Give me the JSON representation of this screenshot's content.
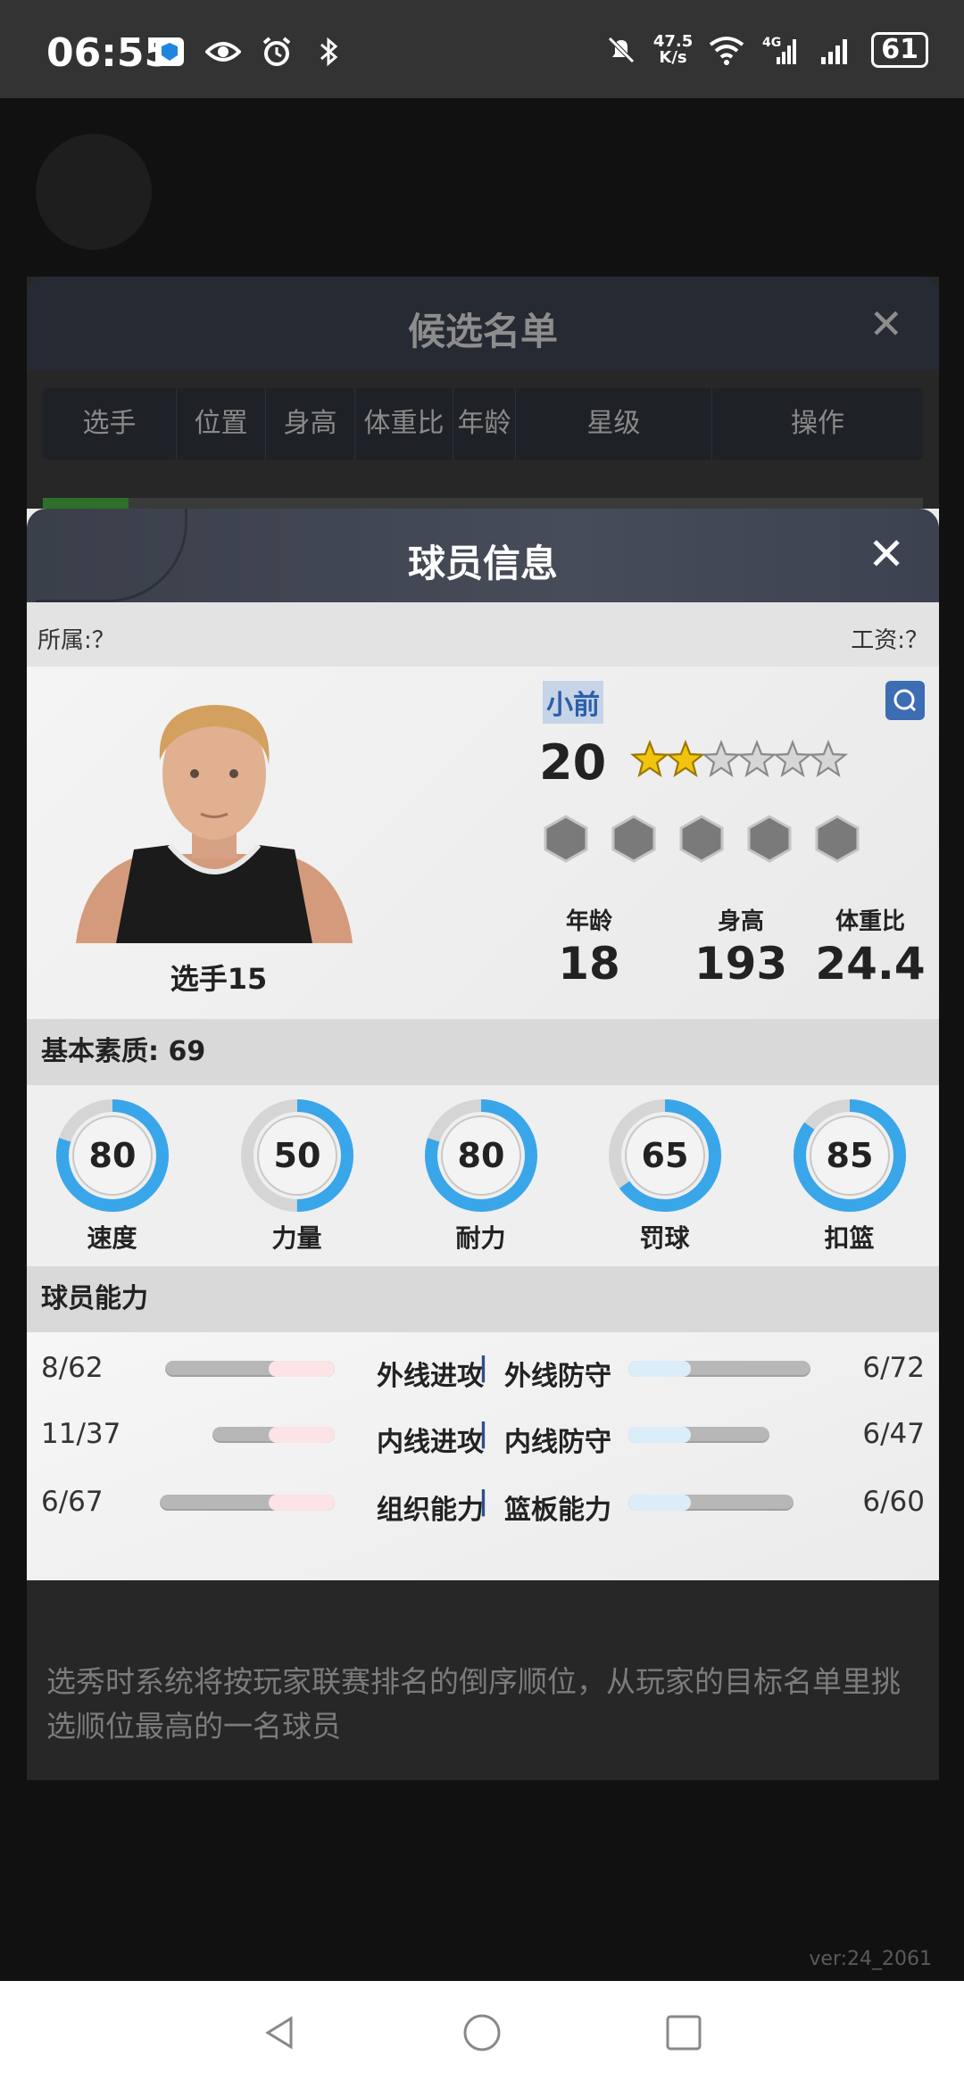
{
  "status_bar": {
    "time": "06:55",
    "net_speed_top": "47.5",
    "net_speed_unit": "K/s",
    "battery": "61"
  },
  "candidate_window": {
    "title": "候选名单",
    "columns": [
      "选手",
      "位置",
      "身高",
      "体重比",
      "年龄",
      "星级",
      "操作"
    ],
    "tip": "选秀时系统将按玩家联赛排名的倒序顺位，从玩家的目标名单里挑选顺位最高的一名球员"
  },
  "modal": {
    "title": "球员信息",
    "affiliation": "所属:？",
    "salary": "工资:？",
    "player_name": "选手15",
    "position": "小前",
    "overall": "20",
    "star_rating": 2,
    "star_max": 6,
    "stats": [
      {
        "key": "年龄",
        "value": "18"
      },
      {
        "key": "身高",
        "value": "193"
      },
      {
        "key": "体重比",
        "value": "24.4"
      }
    ],
    "basic_section": "基本素质: 69",
    "basic_attrs": [
      {
        "label": "速度",
        "value": 80
      },
      {
        "label": "力量",
        "value": 50
      },
      {
        "label": "耐力",
        "value": 80
      },
      {
        "label": "罚球",
        "value": 65
      },
      {
        "label": "扣篮",
        "value": 85
      }
    ],
    "ability_section": "球员能力",
    "abilities": [
      {
        "left_value": "8/62",
        "left_name": "外线进攻",
        "right_name": "外线防守",
        "right_value": "6/72"
      },
      {
        "left_value": "11/37",
        "left_name": "内线进攻",
        "right_name": "内线防守",
        "right_value": "6/47"
      },
      {
        "left_value": "6/67",
        "left_name": "组织能力",
        "right_name": "篮板能力",
        "right_value": "6/60"
      }
    ],
    "separator": "|"
  },
  "version": "ver:24_2061",
  "colors": {
    "ring_blue": "#3aa6ea",
    "attack_fill": "#fbe3e6",
    "defense_fill": "#dcedfa",
    "header_dark": "#3a3f4a"
  }
}
